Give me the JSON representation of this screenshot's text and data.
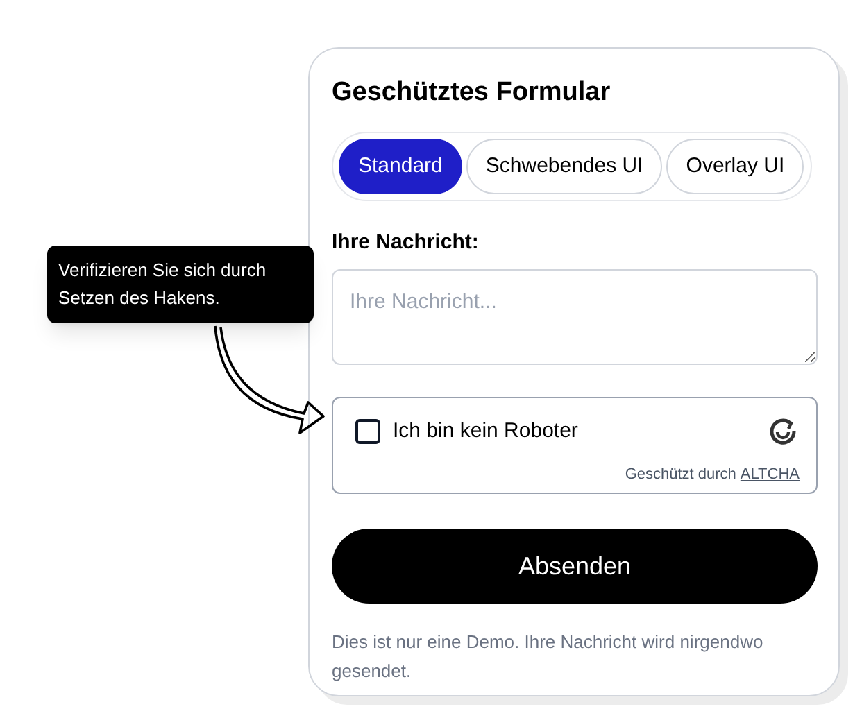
{
  "tooltip": {
    "text": "Verifizieren Sie sich durch Setzen des Hakens."
  },
  "form": {
    "title": "Geschütztes Formular",
    "tabs": [
      {
        "label": "Standard",
        "selected": true
      },
      {
        "label": "Schwebendes UI",
        "selected": false
      },
      {
        "label": "Overlay UI",
        "selected": false
      }
    ],
    "message_label": "Ihre Nachricht:",
    "message_field": {
      "placeholder": "Ihre Nachricht..."
    },
    "captcha": {
      "label": "Ich bin kein Roboter",
      "checked": false,
      "footer": "Geschützt durch",
      "footer_link": "ALTCHA"
    },
    "submit": "Absenden",
    "note": "Dies ist nur eine Demo. Ihre Nachricht wird nirgendwo gesendet."
  }
}
